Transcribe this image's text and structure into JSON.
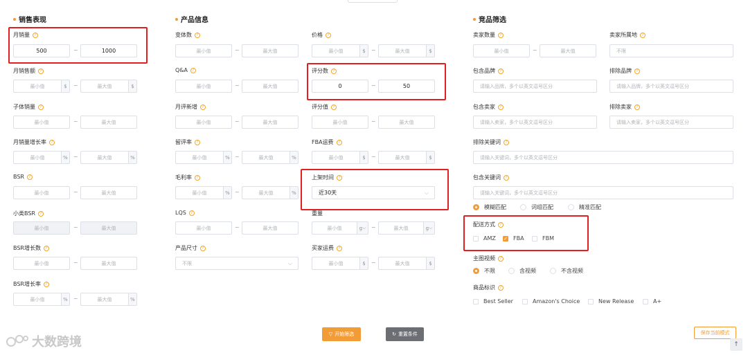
{
  "sections": {
    "sales": "销售表现",
    "product": "产品信息",
    "competitor": "竞品筛选"
  },
  "placeholders": {
    "min": "最小值",
    "max": "最大值",
    "brand": "请输入品牌，多个以英文逗号区分",
    "seller": "请输入卖家，多个以英文逗号区分",
    "keyword": "请输入关键词，多个以英文逗号区分",
    "unlimited": "不限"
  },
  "units": {
    "dollar": "$",
    "percent": "%",
    "gram": "g"
  },
  "sales_fields": {
    "monthly_sales": {
      "label": "月销量",
      "min": "500",
      "max": "1000"
    },
    "monthly_revenue": "月销售额",
    "child_sales": "子体销量",
    "monthly_growth": "月销量增长率",
    "bsr": "BSR",
    "sub_bsr": "小类BSR",
    "bsr_growth_count": "BSR增长数",
    "bsr_growth_rate": "BSR增长率"
  },
  "product_fields": {
    "variants": "变体数",
    "qa": "Q&A",
    "monthly_new_reviews": "月评新增",
    "review_rate": "留评率",
    "gross_margin": "毛利率",
    "lqs": "LQS",
    "size": "产品尺寸",
    "price": "价格",
    "rating_count": {
      "label": "评分数",
      "min": "0",
      "max": "50"
    },
    "rating_value": "评分值",
    "fba_fee": "FBA运费",
    "launch_time": {
      "label": "上架时间",
      "value": "近30天"
    },
    "weight": "重量",
    "buyer_shipping": "买家运费"
  },
  "competitor_fields": {
    "seller_count": "卖家数量",
    "seller_location": "卖家所属地",
    "include_brand": "包含品牌",
    "exclude_brand": "排除品牌",
    "include_seller": "包含卖家",
    "exclude_seller": "排除卖家",
    "exclude_keyword": "排除关键词",
    "include_keyword": "包含关键词",
    "match_modes": [
      "模糊匹配",
      "词组匹配",
      "精准匹配"
    ],
    "delivery": {
      "label": "配送方式",
      "options": [
        "AMZ",
        "FBA",
        "FBM"
      ],
      "checked": "FBA"
    },
    "main_video": {
      "label": "主图视频",
      "options": [
        "不限",
        "含视频",
        "不含视频"
      ],
      "selected": "不限"
    },
    "product_tags": {
      "label": "商品标识",
      "options": [
        "Best Seller",
        "Amazon's Choice",
        "New Release",
        "A+"
      ]
    }
  },
  "buttons": {
    "start": "开始筛选",
    "reset": "重置条件",
    "save": "保存当前模式"
  },
  "brand_watermark": "大数跨境",
  "colors": {
    "accent": "#f29c38",
    "highlight": "#e02020"
  }
}
